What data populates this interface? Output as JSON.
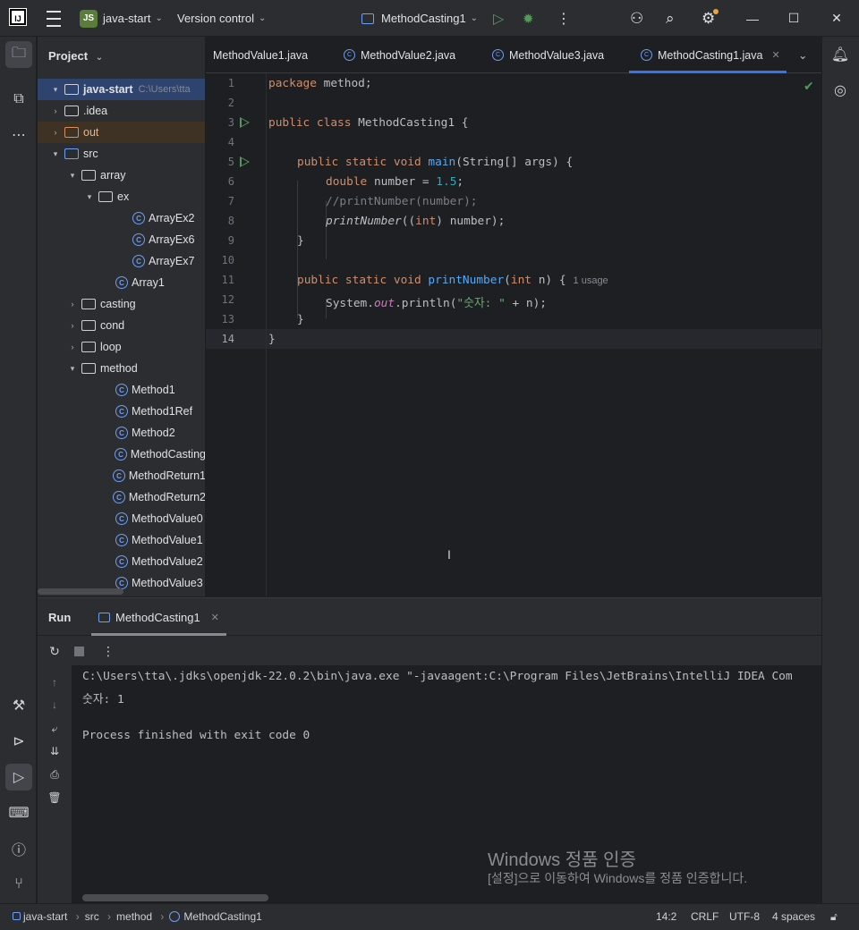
{
  "titlebar": {
    "logo": "IJ",
    "project_badge": "JS",
    "project_name": "java-start",
    "vcs": "Version control",
    "run_config": "MethodCasting1",
    "icons": [
      "menu-icon",
      "run-icon",
      "debug-icon",
      "more-icon",
      "add-user-icon",
      "search-icon",
      "settings-icon",
      "minimize-icon",
      "maximize-icon",
      "close-icon"
    ]
  },
  "project_panel": {
    "title": "Project",
    "root": {
      "name": "java-start",
      "path": "C:\\Users\\tta"
    },
    "items": [
      {
        "label": ".idea",
        "type": "folder"
      },
      {
        "label": "out",
        "type": "folder-excluded"
      },
      {
        "label": "src",
        "type": "source-folder"
      },
      {
        "label": "array",
        "type": "package"
      },
      {
        "label": "ex",
        "type": "package"
      },
      {
        "label": "ArrayEx2",
        "type": "class"
      },
      {
        "label": "ArrayEx6",
        "type": "class"
      },
      {
        "label": "ArrayEx7",
        "type": "class"
      },
      {
        "label": "Array1",
        "type": "class"
      },
      {
        "label": "casting",
        "type": "package"
      },
      {
        "label": "cond",
        "type": "package"
      },
      {
        "label": "loop",
        "type": "package"
      },
      {
        "label": "method",
        "type": "package"
      },
      {
        "label": "Method1",
        "type": "class"
      },
      {
        "label": "Method1Ref",
        "type": "class"
      },
      {
        "label": "Method2",
        "type": "class"
      },
      {
        "label": "MethodCasting",
        "type": "class"
      },
      {
        "label": "MethodReturn1",
        "type": "class"
      },
      {
        "label": "MethodReturn2",
        "type": "class"
      },
      {
        "label": "MethodValue0",
        "type": "class"
      },
      {
        "label": "MethodValue1",
        "type": "class"
      },
      {
        "label": "MethodValue2",
        "type": "class"
      },
      {
        "label": "MethodValue3",
        "type": "class"
      }
    ]
  },
  "editor_tabs": [
    {
      "label": "MethodValue1.java",
      "active": false
    },
    {
      "label": "MethodValue2.java",
      "active": false
    },
    {
      "label": "MethodValue3.java",
      "active": false
    },
    {
      "label": "MethodCasting1.java",
      "active": true
    }
  ],
  "editor": {
    "line_numbers": [
      "1",
      "2",
      "3",
      "4",
      "5",
      "6",
      "7",
      "8",
      "9",
      "10",
      "11",
      "12",
      "13",
      "14"
    ],
    "code": {
      "l1_kw": "package",
      "l1_rest": " method;",
      "l3_kw": "public class",
      "l3_rest": " MethodCasting1 {",
      "l5_kw": "public static void",
      "l5_fn": "main",
      "l5_rest": "(String[] args) {",
      "l6_kw": "double",
      "l6_mid": " number = ",
      "l6_num": "1.5",
      "l6_end": ";",
      "l7_cmt": "//printNumber(number);",
      "l8_fn": "printNumber",
      "l8_a": "((",
      "l8_kw": "int",
      "l8_b": ") number);",
      "l11_kw": "public static void",
      "l11_fn": "printNumber",
      "l11_a": "(",
      "l11_kw2": "int",
      "l11_b": " n) {",
      "l11_hint": "1 usage",
      "l12_a": "System.",
      "l12_out": "out",
      "l12_b": ".println(",
      "l12_str": "\"숫자: \"",
      "l12_c": " + n);",
      "l13": "}",
      "l9": "}",
      "l14": "}"
    }
  },
  "run_panel": {
    "title": "Run",
    "tab": "MethodCasting1",
    "output": [
      "C:\\Users\\tta\\.jdks\\openjdk-22.0.2\\bin\\java.exe \"-javaagent:C:\\Program Files\\JetBrains\\IntelliJ IDEA Com",
      "숫자: 1",
      "",
      "Process finished with exit code 0"
    ]
  },
  "watermark": {
    "line1": "Windows 정품 인증",
    "line2": "[설정]으로 이동하여 Windows를 정품 인증합니다."
  },
  "statusbar": {
    "breadcrumb": [
      "java-start",
      "src",
      "method",
      "MethodCasting1"
    ],
    "position": "14:2",
    "line_ending": "CRLF",
    "encoding": "UTF-8",
    "indent": "4 spaces"
  },
  "colors": {
    "accent": "#3574f0",
    "keyword": "#cf8e6d",
    "function": "#56a8f5",
    "number": "#2aacb8",
    "string": "#6aab73",
    "run_green": "#57965c"
  }
}
